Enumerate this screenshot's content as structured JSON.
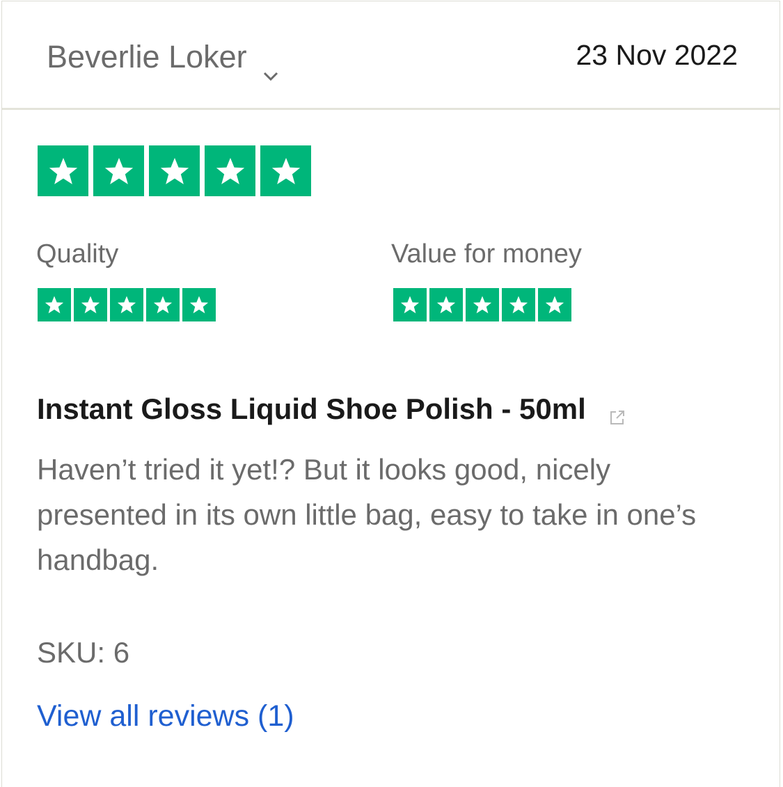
{
  "review": {
    "reviewer_name": "Beverlie Loker",
    "date": "23 Nov 2022",
    "overall_rating": 5,
    "sub_ratings": [
      {
        "label": "Quality",
        "rating": 5
      },
      {
        "label": "Value for money",
        "rating": 5
      }
    ],
    "product_title": "Instant Gloss Liquid Shoe Polish - 50ml",
    "text": "Haven’t tried it yet!? But it looks good, nicely presented in its own little bag, easy to take in one’s handbag.",
    "sku": "SKU: 6",
    "view_all_link": "View all reviews (1)"
  },
  "colors": {
    "star_green": "#00b67a",
    "link_blue": "#1f5fd0"
  },
  "icons": {
    "dropdown": "chevron-down-icon",
    "external": "external-link-icon",
    "star": "star-icon"
  }
}
